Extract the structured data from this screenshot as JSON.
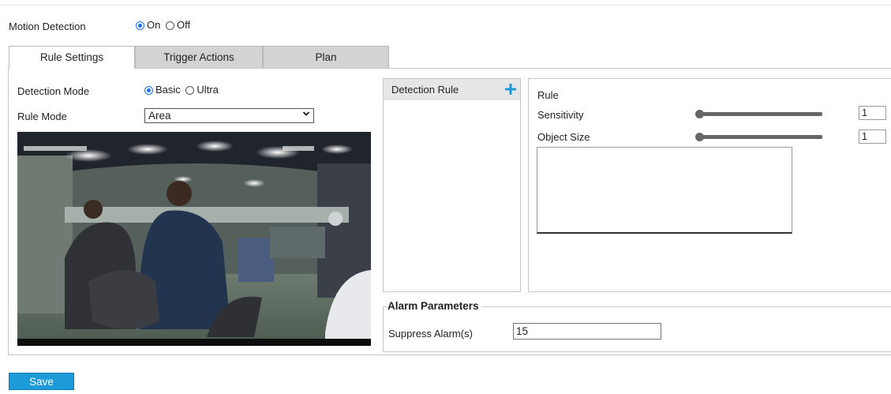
{
  "motion_detection": {
    "label": "Motion Detection",
    "options": [
      "On",
      "Off"
    ],
    "selected": "On"
  },
  "tabs": [
    {
      "label": "Rule Settings",
      "active": true
    },
    {
      "label": "Trigger Actions",
      "active": false
    },
    {
      "label": "Plan",
      "active": false
    }
  ],
  "detection_mode": {
    "label": "Detection Mode",
    "options": [
      "Basic",
      "Ultra"
    ],
    "selected": "Basic"
  },
  "rule_mode": {
    "label": "Rule Mode",
    "value": "Area"
  },
  "detection_rule": {
    "header": "Detection Rule",
    "add_icon": "plus-icon"
  },
  "rule": {
    "title": "Rule",
    "sensitivity": {
      "label": "Sensitivity",
      "value": "1",
      "level": 0
    },
    "object_size": {
      "label": "Object Size",
      "value": "1",
      "level": 0
    }
  },
  "alarm": {
    "title": "Alarm Parameters",
    "suppress_label": "Suppress Alarm(s)",
    "suppress_value": "15"
  },
  "save_label": "Save",
  "colors": {
    "accent": "#1a73e8",
    "save_button": "#1d9bd8",
    "tab_inactive": "#d3d3d3",
    "add_icon": "#1a9bd6"
  }
}
